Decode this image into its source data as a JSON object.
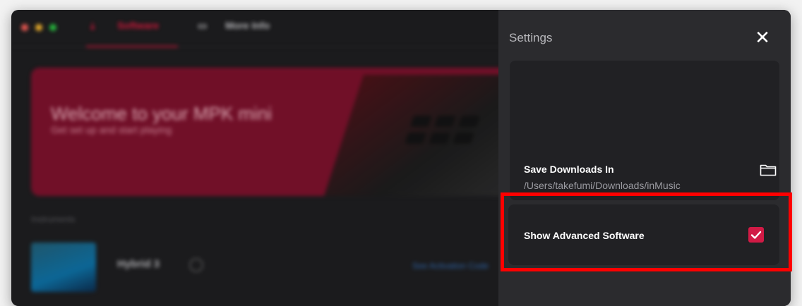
{
  "app": {
    "tabs": [
      {
        "label": "Software"
      },
      {
        "label": "More Info"
      }
    ],
    "banner": {
      "title": "Welcome to your MPK mini",
      "subtitle": "Get set up and start playing"
    },
    "section_label": "Instruments",
    "item": {
      "name": "Hybrid 3",
      "link": "See Activation Code"
    }
  },
  "settings": {
    "title": "Settings",
    "close_icon": "close-icon",
    "save_downloads": {
      "label": "Save Downloads In",
      "path": "/Users/takefumi/Downloads/inMusic",
      "icon": "folder-icon"
    },
    "advanced": {
      "label": "Show Advanced Software",
      "checked": true
    }
  },
  "colors": {
    "accent": "#d11a45",
    "highlight": "#ff0000",
    "panel": "#2b2b2e"
  }
}
